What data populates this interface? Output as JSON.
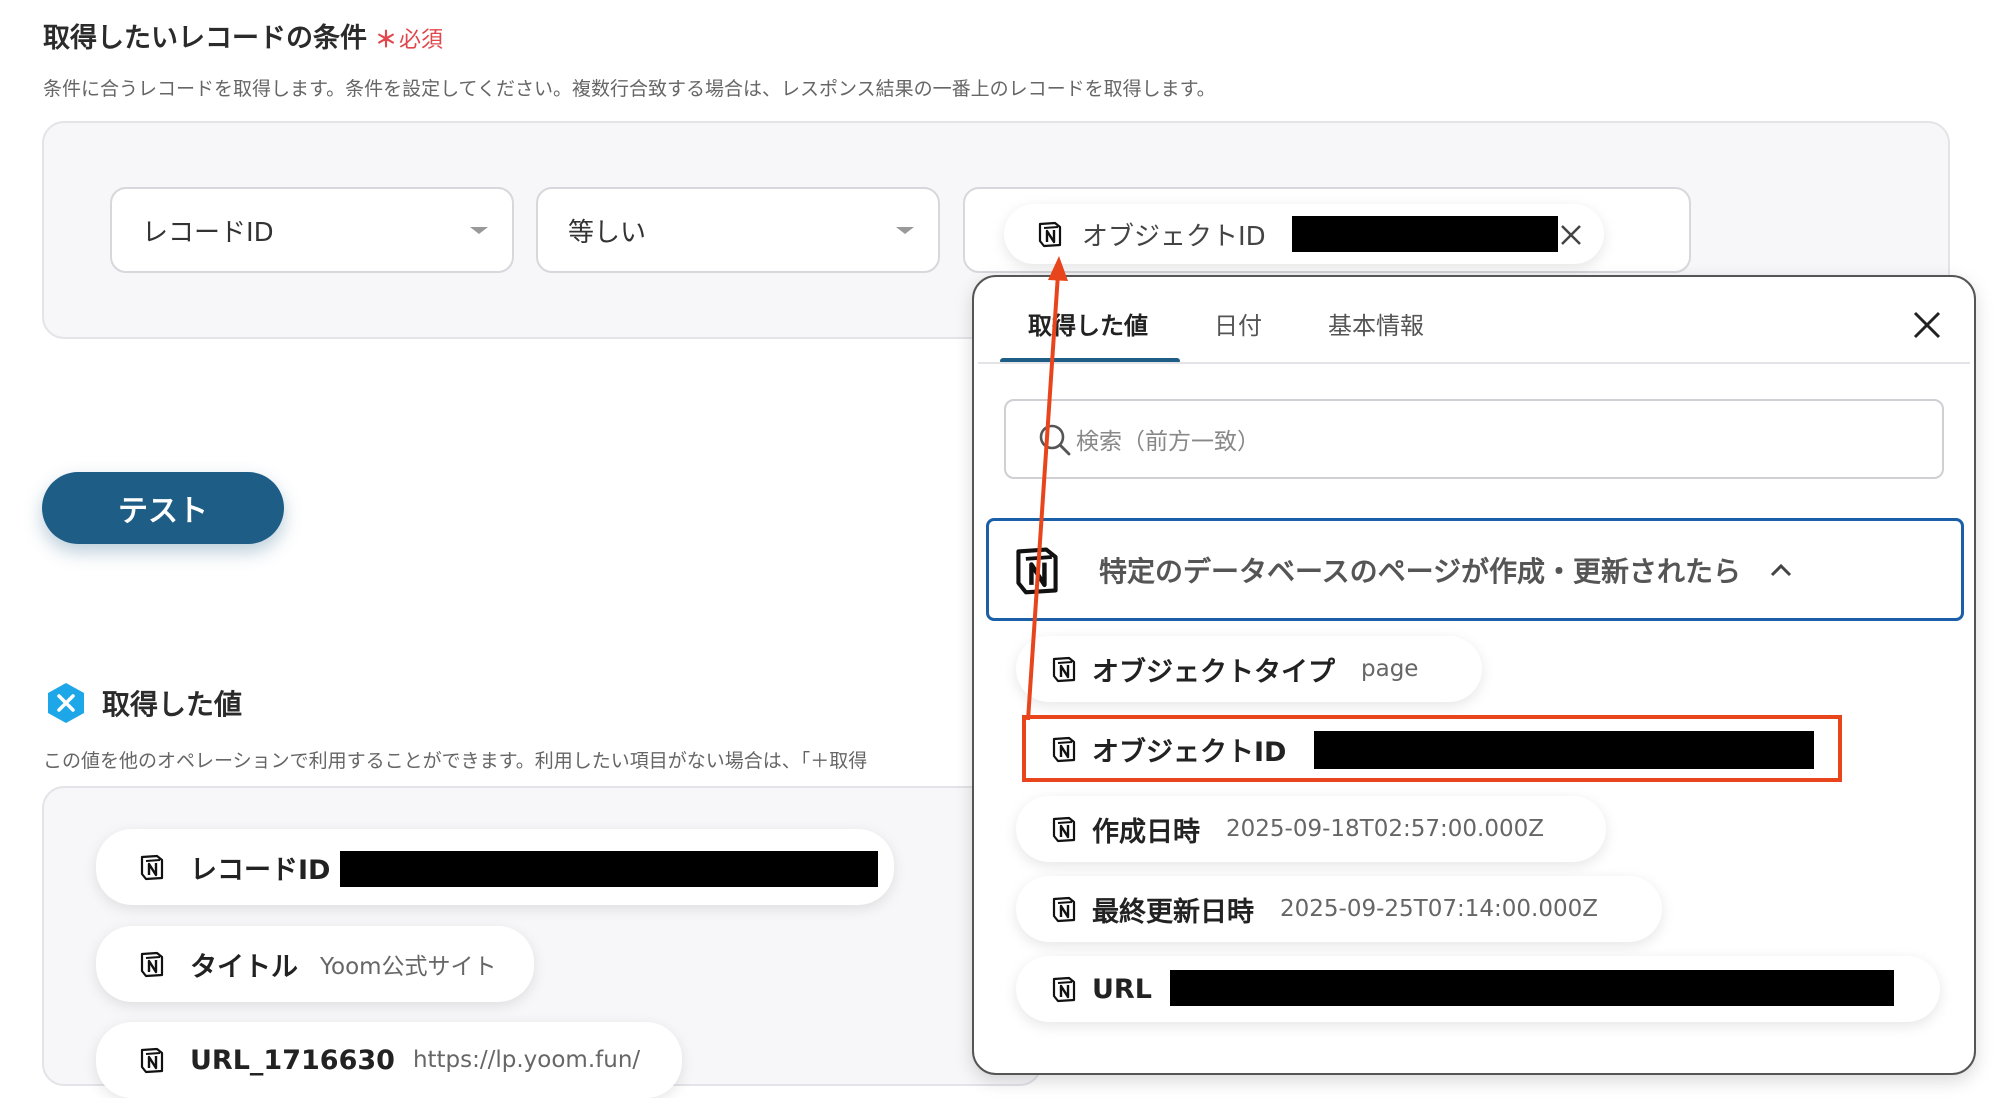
{
  "section": {
    "title": "取得したいレコードの条件",
    "required_mark": "＊",
    "required_label": "必須",
    "description": "条件に合うレコードを取得します。条件を設定してください。複数行合致する場合は、レスポンス結果の一番上のレコードを取得します。"
  },
  "condition": {
    "field": "レコードID",
    "operator": "等しい",
    "value_chip_label": "オブジェクトID"
  },
  "test_button": "テスト",
  "results": {
    "title": "取得した値",
    "description": "この値を他のオペレーションで利用することができます。利用したい項目がない場合は、「＋取得",
    "items": [
      {
        "label": "レコードID",
        "value": ""
      },
      {
        "label": "タイトル",
        "value": "Yoom公式サイト"
      },
      {
        "label": "URL_1716630",
        "value": "https://lp.yoom.fun/"
      }
    ]
  },
  "panel": {
    "tabs": [
      "取得した値",
      "日付",
      "基本情報"
    ],
    "search_placeholder": "検索（前方一致）",
    "group_title": "特定のデータベースのページが作成・更新されたら",
    "items": [
      {
        "label": "オブジェクトタイプ",
        "value": "page"
      },
      {
        "label": "オブジェクトID",
        "value": ""
      },
      {
        "label": "作成日時",
        "value": "2025-09-18T02:57:00.000Z"
      },
      {
        "label": "最終更新日時",
        "value": "2025-09-25T07:14:00.000Z"
      },
      {
        "label": "URL",
        "value": ""
      }
    ]
  },
  "colors": {
    "accent": "#1e5e86",
    "highlight": "#e8451c",
    "group_border": "#1a5fa8",
    "required": "#e0484d"
  },
  "icons": [
    "notion-icon",
    "search-icon",
    "close-icon",
    "chevron-up-icon",
    "dropdown-caret-icon",
    "yoom-badge-icon"
  ]
}
